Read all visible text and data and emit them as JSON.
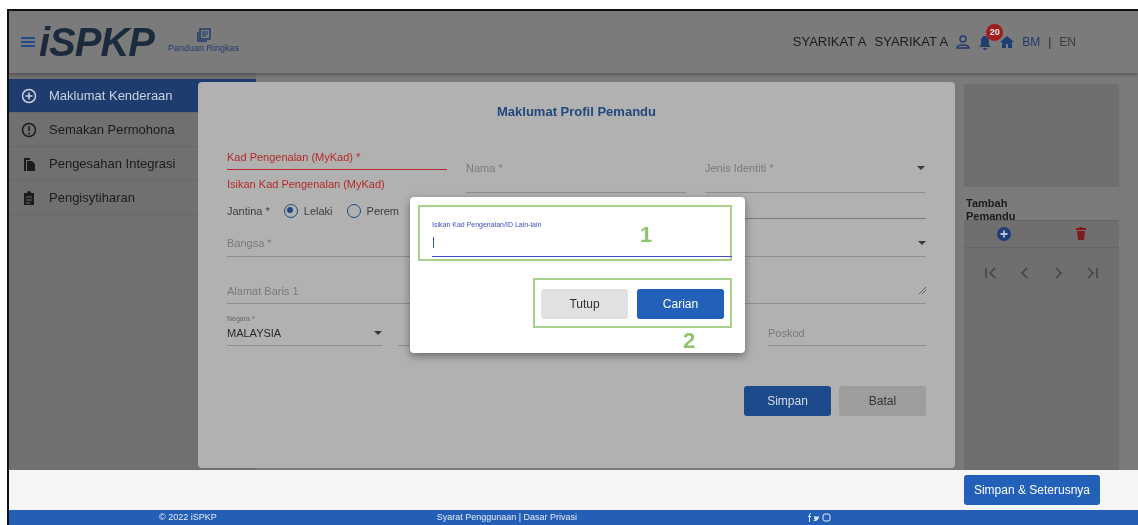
{
  "header": {
    "logo": "iSPKP",
    "guide_link": "Panduan Ringkas",
    "user_name": "SYARIKAT A",
    "company_name": "SYARIKAT A",
    "notification_count": "20",
    "language_separator": "|",
    "languages": [
      {
        "label": "BM",
        "selected": true
      },
      {
        "label": "EN",
        "selected": false
      }
    ]
  },
  "sidebar": {
    "items": [
      {
        "label": "Maklumat Kenderaan",
        "kind": "add",
        "selected": true
      },
      {
        "label": "Semakan Permohona",
        "kind": "alert",
        "selected": false
      },
      {
        "label": "Pengesahan Integrasi",
        "kind": "files",
        "selected": false
      },
      {
        "label": "Pengisytiharan",
        "kind": "clipboard",
        "selected": false
      }
    ]
  },
  "form": {
    "title": "Maklumat Profil Pemandu",
    "id_field": {
      "label": "Kad Pengenalan (MyKad) *",
      "error": "Isikan Kad Pengenalan (MyKad)"
    },
    "name_field": {
      "label": "Nama *"
    },
    "id_type_field": {
      "label": "Jenis Identiti *"
    },
    "gender": {
      "label": "Jantina *",
      "options": [
        {
          "label": "Lelaki",
          "selected": true
        },
        {
          "label": "Perem",
          "selected": false
        }
      ]
    },
    "race_field": {
      "label": "Bangsa *"
    },
    "address_field": {
      "placeholder": "Alamat Baris 1"
    },
    "country_field": {
      "label": "Negara *",
      "value": "MALAYSIA"
    },
    "postcode_field": {
      "label": "Poskod"
    },
    "buttons": [
      {
        "label": "Simpan",
        "kind": "primary"
      },
      {
        "label": "Batal",
        "kind": "secondary"
      }
    ]
  },
  "driver_table": {
    "column_header": "Tambah Pemandu"
  },
  "search_dialog": {
    "field_label": "Isikan Kad Pengenalan/ID Lain-lain",
    "field_annotation": "1",
    "buttons_annotation": "2",
    "buttons": [
      {
        "label": "Tutup",
        "kind": "secondary"
      },
      {
        "label": "Carian",
        "kind": "primary"
      }
    ]
  },
  "bottom_bar": {
    "button": "Simpan & Seterusnya"
  },
  "footer": {
    "copyright": "© 2022 iSPKP",
    "links": "Syarat Penggunaan | Dasar Privasi"
  }
}
